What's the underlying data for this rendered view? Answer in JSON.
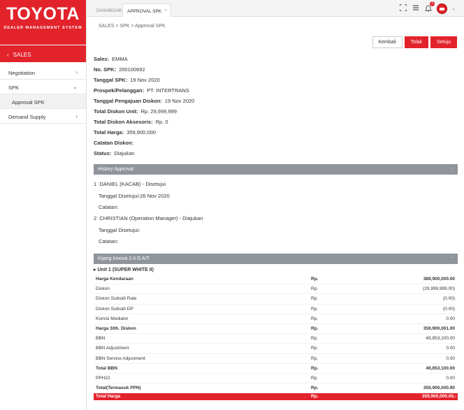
{
  "brand": {
    "logo": "TOYOTA",
    "subtitle": "DEALER MANAGEMENT SYSTEM"
  },
  "sidebar": {
    "section": "SALES",
    "items": [
      {
        "label": "Negotiation",
        "arrow": "›"
      },
      {
        "label": "SPK",
        "arrow": "⌄"
      },
      {
        "label": "Approval SPK",
        "arrow": ""
      },
      {
        "label": "Demand Supply",
        "arrow": "›"
      }
    ]
  },
  "tabs": {
    "dashboard": "DASHBOARD",
    "active": "APPROVAL SPK",
    "close": "×"
  },
  "notifications": {
    "count": "1"
  },
  "breadcrumb": "SALES > SPK > Approval SPK",
  "actions": {
    "back": "Kembali",
    "reject": "Tolak",
    "approve": "Setuju"
  },
  "details": [
    {
      "label": "Sales:",
      "value": "EMMA"
    },
    {
      "label": "No. SPK:",
      "value": "200100692"
    },
    {
      "label": "Tanggal SPK:",
      "value": "19 Nov 2020"
    },
    {
      "label": "Prospek/Pelanggan:",
      "value": "PT. INTERTRANS"
    },
    {
      "label": "Tanggal Pengajuan Diskon:",
      "value": "19 Nov 2020"
    },
    {
      "label": "Total Diskon Unit:",
      "value": "Rp. 29,999,999"
    },
    {
      "label": "Total Diskon Aksesoris:",
      "value": "Rp. 0"
    },
    {
      "label": "Total Harga:",
      "value": "359,900,000"
    },
    {
      "label": "Catatan Diskon:",
      "value": ""
    },
    {
      "label": "Status:",
      "value": "Diajukan"
    }
  ],
  "history": {
    "title": "History Approval",
    "toggle": "-",
    "entries": [
      {
        "no": "1",
        "name": "DANIEL (KACAB) - Disetujui",
        "date_label": "Tanggal Disetujui:26 Nov 2020",
        "note_label": "Catatan:"
      },
      {
        "no": "2",
        "name": "CHRISTIAN (Operation Manager) - Diajukan",
        "date_label": "Tanggal Disetujui:",
        "note_label": "Catatan:"
      }
    ]
  },
  "vehicle": {
    "title": "Kijang Innova 2.4 G A/T",
    "toggle": "-",
    "unit": "▸ Unit 1 (SUPER WHITE II)",
    "rows": [
      {
        "label": "Harga Kendaraan",
        "cur": "Rp.",
        "amount": "389,900,000.00",
        "bold": true
      },
      {
        "label": "Diskon",
        "cur": "Rp.",
        "amount": "(29,999,999.00)",
        "bold": false
      },
      {
        "label": "Diskon Subsidi Rate",
        "cur": "Rp.",
        "amount": "(0.00)",
        "bold": false
      },
      {
        "label": "Diskon Subsidi DP",
        "cur": "Rp.",
        "amount": "(0.00)",
        "bold": false
      },
      {
        "label": "Komisi Mediator",
        "cur": "Rp.",
        "amount": "0.00",
        "bold": false
      },
      {
        "label": "Harga Stlh. Diskon",
        "cur": "Rp.",
        "amount": "359,900,001.00",
        "bold": true
      },
      {
        "label": "BBN",
        "cur": "Rp.",
        "amount": "49,853,100.00",
        "bold": false
      },
      {
        "label": "BBN Adjustment",
        "cur": "Rp.",
        "amount": "0.00",
        "bold": false
      },
      {
        "label": "BBN Service Adjustment",
        "cur": "Rp.",
        "amount": "0.00",
        "bold": false
      },
      {
        "label": "Total BBN",
        "cur": "Rp.",
        "amount": "49,853,100.00",
        "bold": true
      },
      {
        "label": "PPH22",
        "cur": "Rp.",
        "amount": "0.00",
        "bold": false
      },
      {
        "label": "Total(Termasuk PPN)",
        "cur": "Rp.",
        "amount": "359,900,000.90",
        "bold": true
      }
    ],
    "total": {
      "label": "Total Harga",
      "cur": "Rp.",
      "amount": "359,900,000.00,-"
    }
  },
  "colors": {
    "brand_red": "#e3232b",
    "panel_gray": "#8f959b"
  }
}
